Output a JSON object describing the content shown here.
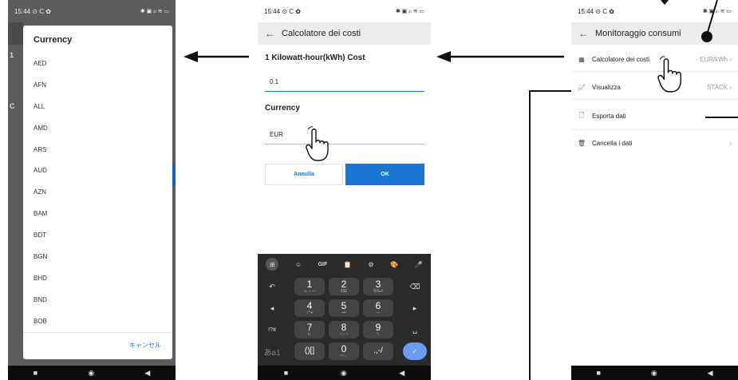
{
  "status": {
    "time": "15:44",
    "left_icons": "⊙ C ✿",
    "right_icons": "✱ ▣ ᵢₗₗ ≋ ▭"
  },
  "nav": {
    "recents": "■",
    "home": "◉",
    "back": "◀"
  },
  "phone1": {
    "dialog_title": "Currency",
    "currencies": [
      "AED",
      "AFN",
      "ALL",
      "AMD",
      "ARS",
      "AUD",
      "AZN",
      "BAM",
      "BDT",
      "BGN",
      "BHD",
      "BND",
      "BOB"
    ],
    "cancel_label": "キャンセル",
    "behind_letters": [
      "1",
      "C"
    ]
  },
  "phone2": {
    "title": "Calcolatore dei costi",
    "cost_label": "1 Kilowatt-hour(kWh) Cost",
    "cost_value": "0.1",
    "currency_label": "Currency",
    "currency_value": "EUR",
    "cancel_button": "Annulla",
    "ok_button": "OK",
    "keyboard": {
      "toolbar": [
        "⊞",
        "☺",
        "GIF",
        "📋",
        "⚙",
        "🎨",
        "🎤"
      ],
      "rows": [
        [
          {
            "main": "1",
            "sub": "☺ ♪ —"
          },
          {
            "main": "2",
            "sub": "€$£"
          },
          {
            "main": "3",
            "sub": "%‰#"
          }
        ],
        [
          {
            "main": "4",
            "sub": "○*∗"
          },
          {
            "main": "5",
            "sub": "•••"
          },
          {
            "main": "6",
            "sub": "—"
          }
        ],
        [
          {
            "main": "7",
            "sub": "¹⁄₂"
          },
          {
            "main": "8",
            "sub": "☆♂♀"
          },
          {
            "main": "9",
            "sub": "°₍"
          }
        ],
        [
          {
            "main": "()[]",
            "sub": ""
          },
          {
            "main": "0",
            "sub": "〜…"
          },
          {
            "main": ".,-/",
            "sub": ""
          }
        ]
      ],
      "left_keys": [
        "↶",
        "◂",
        "!?#",
        "あa1"
      ],
      "right_keys": [
        "⌫",
        "▸",
        "␣",
        "✓"
      ]
    }
  },
  "phone3": {
    "title": "Monitoraggio consumi",
    "rows": [
      {
        "icon": "calculator-icon",
        "glyph": "▦",
        "label": "Calcolatore dei costi",
        "value": "- EUR/kWh",
        "chevron": "›"
      },
      {
        "icon": "chart-icon",
        "glyph": "📈",
        "label": "Visualizza",
        "value": "STACK",
        "chevron": "›"
      },
      {
        "icon": "export-icon",
        "glyph": "🗋",
        "label": "Esporta dati",
        "value": "",
        "chevron": ""
      },
      {
        "icon": "trash-icon",
        "glyph": "🗑",
        "label": "Cancella i dati",
        "value": "",
        "chevron": "›"
      }
    ]
  },
  "colors": {
    "accent": "#1a73e8",
    "ok_button": "#1976d2",
    "keyboard": "#2a2a2a",
    "confirm_key": "#6b9bf2"
  }
}
